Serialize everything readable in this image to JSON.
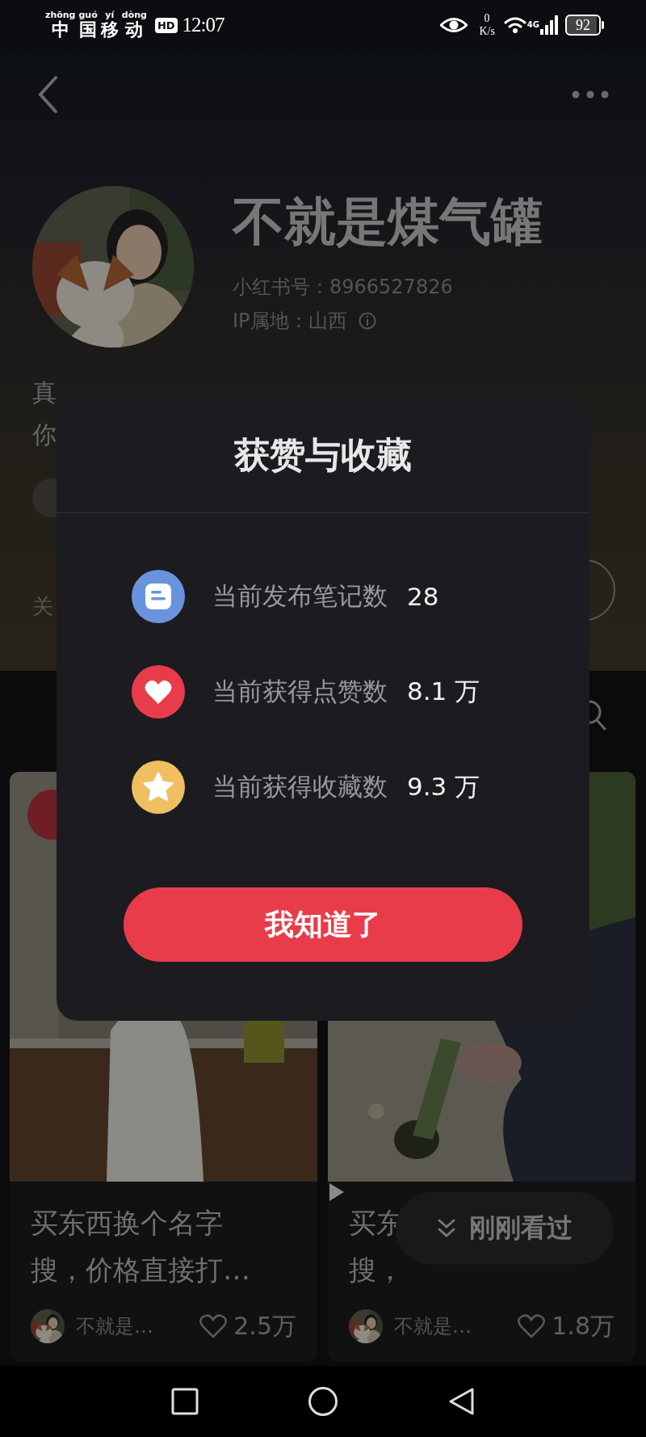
{
  "status_bar": {
    "carrier": [
      {
        "pinyin": "zhōng",
        "char": "中"
      },
      {
        "pinyin": "guó",
        "char": "国"
      },
      {
        "pinyin": "yí",
        "char": "移"
      },
      {
        "pinyin": "dòng",
        "char": "动"
      }
    ],
    "hd_badge": "HD",
    "time": "12:07",
    "net_speed_value": "0",
    "net_speed_unit": "K/s",
    "network_type": "4G",
    "battery": "92"
  },
  "profile": {
    "name": "不就是煤气罐",
    "id_line": "小红书号：8966527826",
    "ip_line": "IP属地：山西",
    "bio_lines": [
      "真",
      "你"
    ],
    "stat_label": "关"
  },
  "feed": {
    "cards": [
      {
        "pinned": true,
        "title_lines": [
          "买东西换个名字",
          "搜，价格直接打…"
        ],
        "author": "不就是…",
        "likes": "2.5万"
      },
      {
        "title_lines": [
          "买东",
          "搜，"
        ],
        "author": "不就是…",
        "likes": "1.8万"
      }
    ]
  },
  "recent_button": {
    "label": "刚刚看过"
  },
  "dialog": {
    "title": "获赞与收藏",
    "rows": [
      {
        "kind": "notes",
        "label": "当前发布笔记数",
        "value": "28",
        "color": "#6a93dd"
      },
      {
        "kind": "likes",
        "label": "当前获得点赞数",
        "value": "8.1 万",
        "color": "#e83c4a"
      },
      {
        "kind": "collects",
        "label": "当前获得收藏数",
        "value": "9.3 万",
        "color": "#f0bf62"
      }
    ],
    "button": "我知道了"
  }
}
